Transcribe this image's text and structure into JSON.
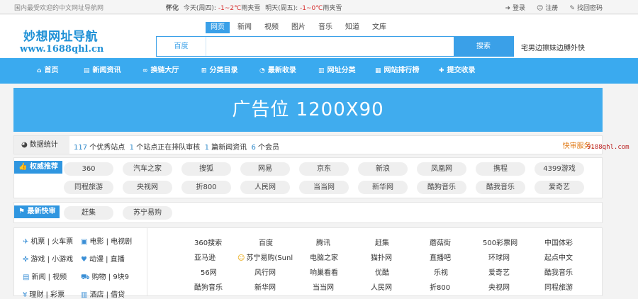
{
  "topbar": {
    "welcome": "国内最受欢迎的中文网址导航网",
    "city": "怀化",
    "today_label": "今天(周四):",
    "today_temp": "-1~2℃",
    "today_weather": "雨夹雪",
    "tomorrow_label": "明天(周五):",
    "tomorrow_temp": "-1~0℃",
    "tomorrow_weather": "雨夹雪",
    "login": "登录",
    "register": "注册",
    "recover": "找回密码"
  },
  "logo": {
    "title": "妙想网址导航",
    "url": "www.1688qhl.cn"
  },
  "search": {
    "tabs": [
      "网页",
      "新闻",
      "视频",
      "图片",
      "音乐",
      "知道",
      "文库"
    ],
    "engine": "百度",
    "query": "",
    "button": "搜索",
    "hotword": "宅男边擦妹边膊外快"
  },
  "nav": [
    "首页",
    "新闻资讯",
    "换链大厅",
    "分类目录",
    "最新收录",
    "网址分类",
    "网站排行榜",
    "提交收录"
  ],
  "banner": "广告位 1200X90",
  "stats": {
    "label": "数据统计",
    "sites_count": "117",
    "sites_text": "个优秀站点",
    "queue_count": "1",
    "queue_text": "个站点正在排队审核",
    "news_count": "1",
    "news_text": "篇新闻资讯",
    "members_count": "6",
    "members_text": "个会员",
    "service": "快审服务:"
  },
  "side_domain": "9188qhl.com",
  "recommend": {
    "label": "权威推荐",
    "row1": [
      "360",
      "汽车之家",
      "搜狐",
      "网易",
      "京东",
      "新浪",
      "凤凰网",
      "携程",
      "4399游戏"
    ],
    "row2": [
      "同程旅游",
      "央视网",
      "折800",
      "人民网",
      "当当网",
      "新华网",
      "酷狗音乐",
      "酷我音乐",
      "爱奇艺"
    ]
  },
  "express": {
    "label": "最新快审",
    "items": [
      "赶集",
      "苏宁易购"
    ]
  },
  "left_links": [
    [
      "机票 | 火车票",
      "电影 | 电视剧"
    ],
    [
      "游戏 | 小游戏",
      "动漫 | 直播"
    ],
    [
      "新闻 | 视频",
      "购物 | 9块9"
    ],
    [
      "理财 | 彩票",
      "酒店 | 借贷"
    ]
  ],
  "right_links": [
    [
      "360搜索",
      "百度",
      "腾讯",
      "赶集",
      "蘑菇街",
      "500彩票网",
      "中国体彩"
    ],
    [
      "亚马逊",
      "苏宁易购(Sunl",
      "电脑之家",
      "猫扑网",
      "直播吧",
      "环球网",
      "起点中文"
    ],
    [
      "56网",
      "风行网",
      "响巢看看",
      "优酷",
      "乐视",
      "爱奇艺",
      "酷我音乐"
    ],
    [
      "酷狗音乐",
      "新华网",
      "当当网",
      "人民网",
      "折800",
      "央视网",
      "同程旅游"
    ]
  ]
}
